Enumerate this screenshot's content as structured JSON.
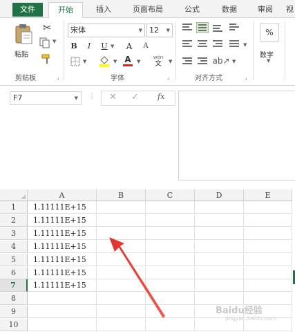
{
  "ribbon_tabs": [
    "文件",
    "开始",
    "插入",
    "页面布局",
    "公式",
    "数据",
    "审阅",
    "视"
  ],
  "clipboard": {
    "paste_label": "粘贴",
    "group_label": "剪贴板"
  },
  "font": {
    "name": "宋体",
    "size": "12",
    "bold": "B",
    "italic": "I",
    "underline": "U",
    "grow": "A",
    "shrink": "A",
    "font_color": "A",
    "phonetic": "wén",
    "group_label": "字体"
  },
  "alignment": {
    "group_label": "对齐方式"
  },
  "number": {
    "percent": "%",
    "label": "数字"
  },
  "formula_bar": {
    "name_box": "F7",
    "fx": "fx",
    "cancel": "✕",
    "enter": "✓",
    "dots": "⋮"
  },
  "columns": [
    "A",
    "B",
    "C",
    "D",
    "E"
  ],
  "rows": [
    "1",
    "2",
    "3",
    "4",
    "5",
    "6",
    "7",
    "8",
    "9",
    "10"
  ],
  "cells_A": [
    "1.11111E+15",
    "1.11111E+15",
    "1.11111E+15",
    "1.11111E+15",
    "1.11111E+15",
    "1.11111E+15",
    "1.11111E+15",
    "",
    "",
    ""
  ],
  "selected_row": "7",
  "watermark": {
    "text": "Baidu经验",
    "sub": "jingyan.baidu.com"
  },
  "colors": {
    "accent": "#217346",
    "arrow": "#e0302a"
  }
}
